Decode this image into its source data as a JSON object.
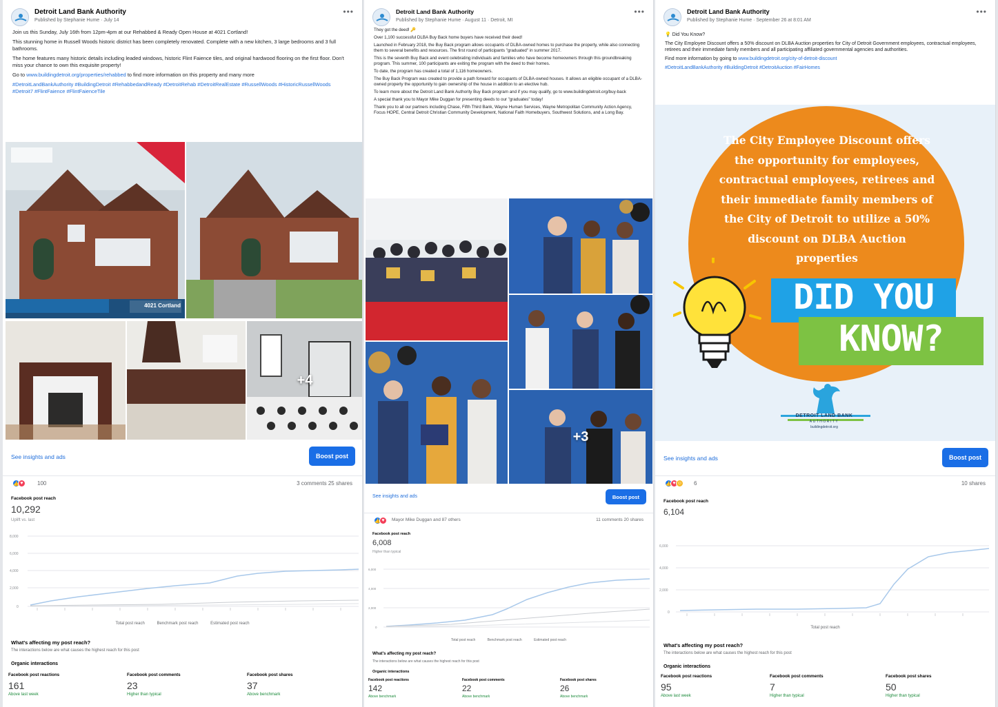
{
  "posts": [
    {
      "page_name": "Detroit Land Bank Authority",
      "published_line": "Published by Stephanie Hume · July 14",
      "paragraphs": [
        "Join us this Sunday, July 16th from 12pm-4pm at our Rehabbed & Ready Open House at 4021 Cortland!",
        "This stunning home in Russell Woods historic district has been completely renovated. Complete with a new kitchen, 3 large bedrooms and 3 full bathrooms.",
        "The home features many historic details including leaded windows, historic Flint Faience tiles, and original hardwood flooring on the first floor. Don't miss your chance to own this exquisite property!"
      ],
      "link_prefix": "Go to",
      "link": "www.buildingdetroit.org/properties/rehabbed",
      "link_suffix": "to find more information on this property and many more",
      "hashtags": "#DetroitLandBankAuthority #BuildingDetroit #RehabbedandReady #DetroitRehab #DetroitRealEstate #RussellWoods #HistoricRussellWoods #Detroit7 #FlintFaience #FlintFaienceTile",
      "photo_badge": "4021 Cortland",
      "more_photos": "+4",
      "insights_link": "See insights and ads",
      "boost_label": "Boost post",
      "reaction_count": "100",
      "reaction_right": "3 comments  25 shares",
      "metric_label": "Facebook post reach",
      "metric_value": "10,292",
      "metric_sub": "Uplift vs. last",
      "y_ticks": [
        "8,000",
        "6,000",
        "4,000",
        "2,000",
        "0"
      ],
      "legend": [
        "Total post reach",
        "Benchmark post reach",
        "Estimated post reach"
      ],
      "affecting_title": "What's affecting my post reach?",
      "affecting_sub": "The interactions below are what causes the highest reach for this post",
      "interactions_title": "Organic interactions",
      "stats": [
        {
          "label": "Facebook post reactions",
          "value": "161",
          "change": "Above last week"
        },
        {
          "label": "Facebook post comments",
          "value": "23",
          "change": "Higher than typical"
        },
        {
          "label": "Facebook post shares",
          "value": "37",
          "change": "Above benchmark"
        }
      ]
    },
    {
      "page_name": "Detroit Land Bank Authority",
      "published_line": "Published by Stephanie Hume · August 11 · Detroit, MI",
      "paragraphs": [
        "They got the deed! 🔑",
        "Over 1,100 successful DLBA Buy Back home buyers have received their deed!",
        "Launched in February 2018, the Buy Back program allows occupants of DLBA-owned homes to purchase the property, while also connecting them to several benefits and resources. The first round of participants \"graduated\" in summer 2017.",
        "This is the seventh Buy Back and event celebrating individuals and families who have become homeowners through this groundbreaking program. This summer, 100 participants are exiting the program with the deed to their homes.",
        "To date, the program has created a total of 1,116 homeowners.",
        "The Buy Back Program was created to provide a path forward for occupants of DLBA-owned houses. It allows an eligible occupant of a DLBA-owned property the opportunity to gain ownership of the house in addition to an elective hub.",
        "To learn more about the Detroit Land Bank Authority Buy Back program and if you may qualify, go to www.buildingdetroit.org/buy-back"
      ],
      "thanks_line": "A special thank you to Mayor Mike Duggan for presenting deeds to our \"graduates\" today!",
      "partners_line": "Thank you to all our partners including Chase, Fifth Third Bank, Wayne Human Services, Wayne Metropolitan Community Action Agency, Focus HOPE, Central Detroit Christian Community Development, National Faith Homebuyers, Southwest Solutions, and a Long Bay.",
      "more_photos": "+3",
      "insights_link": "See insights and ads",
      "boost_label": "Boost post",
      "reaction_count": "Mayor Mike Duggan and 87 others",
      "reaction_right": "11 comments  20 shares",
      "metric_label": "Facebook post reach",
      "metric_value": "6,008",
      "metric_sub": "Higher than typical",
      "y_ticks": [
        "6,000",
        "4,000",
        "2,000",
        "0"
      ],
      "legend": [
        "Total post reach",
        "Benchmark post reach",
        "Estimated post reach"
      ],
      "affecting_title": "What's affecting my post reach?",
      "affecting_sub": "The interactions below are what causes the highest reach for this post",
      "interactions_title": "Organic interactions",
      "stats": [
        {
          "label": "Facebook post reactions",
          "value": "142",
          "change": "Above benchmark"
        },
        {
          "label": "Facebook post comments",
          "value": "22",
          "change": "Above benchmark"
        },
        {
          "label": "Facebook post shares",
          "value": "26",
          "change": "Above benchmark"
        }
      ]
    },
    {
      "page_name": "Detroit Land Bank Authority",
      "published_line": "Published by Stephanie Hume · September 26 at 8:01 AM",
      "paragraphs": [
        "💡 Did You Know?",
        "The City Employee Discount offers a 50% discount on DLBA Auction properties for City of Detroit Government employees, contractual employees, retirees and their immediate family members and all participating affiliated governmental agencies and authorities."
      ],
      "link_prefix": "Find more information by going to",
      "link": "www.buildingdetroit.org/city-of-detroit-discount",
      "hashtags": "#DetroitLandBankAuthority #BuildingDetroit #DetroitAuction #FairHomes",
      "graphic": {
        "headline": "The City Employee Discount offers the opportunity for employees, contractual employees, retirees and their immediate family members of the City of Detroit to utilize a 50% discount on DLBA Auction properties",
        "did": "DID YOU",
        "know": "KNOW?",
        "logo_name": "DETROIT LAND BANK",
        "logo_sub": "AUTHORITY",
        "logo_url": "buildingdetroit.org",
        "colors": {
          "orange": "#ed8a1c",
          "blue": "#1fa2e6",
          "green": "#7dc243"
        }
      },
      "insights_link": "See insights and ads",
      "boost_label": "Boost post",
      "reaction_count": "6",
      "reaction_right": "10 shares",
      "metric_label": "Facebook post reach",
      "metric_value": "6,104",
      "y_ticks": [
        "6,000",
        "4,000",
        "2,000",
        "0"
      ],
      "legend": [
        "Total post reach"
      ],
      "affecting_title": "What's affecting my post reach?",
      "affecting_sub": "The interactions below are what causes the highest reach for this post",
      "interactions_title": "Organic interactions",
      "stats": [
        {
          "label": "Facebook post reactions",
          "value": "95",
          "change": "Above last week"
        },
        {
          "label": "Facebook post comments",
          "value": "7",
          "change": "Higher than typical"
        },
        {
          "label": "Facebook post shares",
          "value": "50",
          "change": "Higher than typical"
        }
      ]
    }
  ],
  "colors": {
    "accent": "#1a6ee6",
    "link": "#216fdb",
    "chart_line": "#a8c8ea"
  }
}
